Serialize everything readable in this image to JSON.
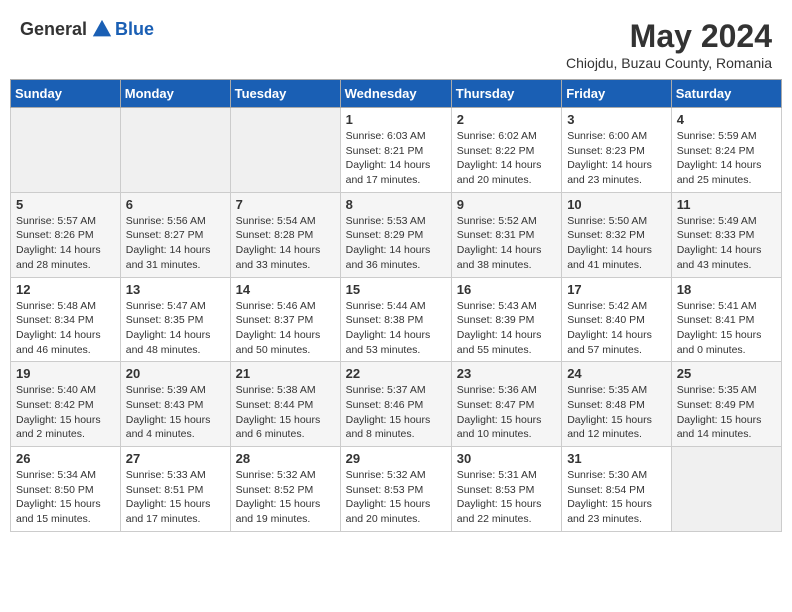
{
  "header": {
    "logo_general": "General",
    "logo_blue": "Blue",
    "month_year": "May 2024",
    "location": "Chiojdu, Buzau County, Romania"
  },
  "weekdays": [
    "Sunday",
    "Monday",
    "Tuesday",
    "Wednesday",
    "Thursday",
    "Friday",
    "Saturday"
  ],
  "weeks": [
    [
      {
        "day": "",
        "info": ""
      },
      {
        "day": "",
        "info": ""
      },
      {
        "day": "",
        "info": ""
      },
      {
        "day": "1",
        "info": "Sunrise: 6:03 AM\nSunset: 8:21 PM\nDaylight: 14 hours\nand 17 minutes."
      },
      {
        "day": "2",
        "info": "Sunrise: 6:02 AM\nSunset: 8:22 PM\nDaylight: 14 hours\nand 20 minutes."
      },
      {
        "day": "3",
        "info": "Sunrise: 6:00 AM\nSunset: 8:23 PM\nDaylight: 14 hours\nand 23 minutes."
      },
      {
        "day": "4",
        "info": "Sunrise: 5:59 AM\nSunset: 8:24 PM\nDaylight: 14 hours\nand 25 minutes."
      }
    ],
    [
      {
        "day": "5",
        "info": "Sunrise: 5:57 AM\nSunset: 8:26 PM\nDaylight: 14 hours\nand 28 minutes."
      },
      {
        "day": "6",
        "info": "Sunrise: 5:56 AM\nSunset: 8:27 PM\nDaylight: 14 hours\nand 31 minutes."
      },
      {
        "day": "7",
        "info": "Sunrise: 5:54 AM\nSunset: 8:28 PM\nDaylight: 14 hours\nand 33 minutes."
      },
      {
        "day": "8",
        "info": "Sunrise: 5:53 AM\nSunset: 8:29 PM\nDaylight: 14 hours\nand 36 minutes."
      },
      {
        "day": "9",
        "info": "Sunrise: 5:52 AM\nSunset: 8:31 PM\nDaylight: 14 hours\nand 38 minutes."
      },
      {
        "day": "10",
        "info": "Sunrise: 5:50 AM\nSunset: 8:32 PM\nDaylight: 14 hours\nand 41 minutes."
      },
      {
        "day": "11",
        "info": "Sunrise: 5:49 AM\nSunset: 8:33 PM\nDaylight: 14 hours\nand 43 minutes."
      }
    ],
    [
      {
        "day": "12",
        "info": "Sunrise: 5:48 AM\nSunset: 8:34 PM\nDaylight: 14 hours\nand 46 minutes."
      },
      {
        "day": "13",
        "info": "Sunrise: 5:47 AM\nSunset: 8:35 PM\nDaylight: 14 hours\nand 48 minutes."
      },
      {
        "day": "14",
        "info": "Sunrise: 5:46 AM\nSunset: 8:37 PM\nDaylight: 14 hours\nand 50 minutes."
      },
      {
        "day": "15",
        "info": "Sunrise: 5:44 AM\nSunset: 8:38 PM\nDaylight: 14 hours\nand 53 minutes."
      },
      {
        "day": "16",
        "info": "Sunrise: 5:43 AM\nSunset: 8:39 PM\nDaylight: 14 hours\nand 55 minutes."
      },
      {
        "day": "17",
        "info": "Sunrise: 5:42 AM\nSunset: 8:40 PM\nDaylight: 14 hours\nand 57 minutes."
      },
      {
        "day": "18",
        "info": "Sunrise: 5:41 AM\nSunset: 8:41 PM\nDaylight: 15 hours\nand 0 minutes."
      }
    ],
    [
      {
        "day": "19",
        "info": "Sunrise: 5:40 AM\nSunset: 8:42 PM\nDaylight: 15 hours\nand 2 minutes."
      },
      {
        "day": "20",
        "info": "Sunrise: 5:39 AM\nSunset: 8:43 PM\nDaylight: 15 hours\nand 4 minutes."
      },
      {
        "day": "21",
        "info": "Sunrise: 5:38 AM\nSunset: 8:44 PM\nDaylight: 15 hours\nand 6 minutes."
      },
      {
        "day": "22",
        "info": "Sunrise: 5:37 AM\nSunset: 8:46 PM\nDaylight: 15 hours\nand 8 minutes."
      },
      {
        "day": "23",
        "info": "Sunrise: 5:36 AM\nSunset: 8:47 PM\nDaylight: 15 hours\nand 10 minutes."
      },
      {
        "day": "24",
        "info": "Sunrise: 5:35 AM\nSunset: 8:48 PM\nDaylight: 15 hours\nand 12 minutes."
      },
      {
        "day": "25",
        "info": "Sunrise: 5:35 AM\nSunset: 8:49 PM\nDaylight: 15 hours\nand 14 minutes."
      }
    ],
    [
      {
        "day": "26",
        "info": "Sunrise: 5:34 AM\nSunset: 8:50 PM\nDaylight: 15 hours\nand 15 minutes."
      },
      {
        "day": "27",
        "info": "Sunrise: 5:33 AM\nSunset: 8:51 PM\nDaylight: 15 hours\nand 17 minutes."
      },
      {
        "day": "28",
        "info": "Sunrise: 5:32 AM\nSunset: 8:52 PM\nDaylight: 15 hours\nand 19 minutes."
      },
      {
        "day": "29",
        "info": "Sunrise: 5:32 AM\nSunset: 8:53 PM\nDaylight: 15 hours\nand 20 minutes."
      },
      {
        "day": "30",
        "info": "Sunrise: 5:31 AM\nSunset: 8:53 PM\nDaylight: 15 hours\nand 22 minutes."
      },
      {
        "day": "31",
        "info": "Sunrise: 5:30 AM\nSunset: 8:54 PM\nDaylight: 15 hours\nand 23 minutes."
      },
      {
        "day": "",
        "info": ""
      }
    ]
  ]
}
